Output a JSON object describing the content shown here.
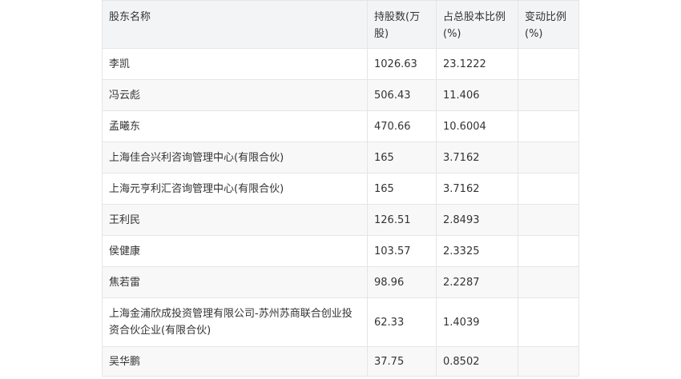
{
  "headers": [
    "股东名称",
    "持股数(万股)",
    "占总股本比例(%)",
    "变动比例(%)"
  ],
  "rows": [
    [
      "李凯",
      "1026.63",
      "23.1222",
      ""
    ],
    [
      "冯云彪",
      "506.43",
      "11.406",
      ""
    ],
    [
      "孟曦东",
      "470.66",
      "10.6004",
      ""
    ],
    [
      "上海佳合兴利咨询管理中心(有限合伙)",
      "165",
      "3.7162",
      ""
    ],
    [
      "上海元亨利汇咨询管理中心(有限合伙)",
      "165",
      "3.7162",
      ""
    ],
    [
      "王利民",
      "126.51",
      "2.8493",
      ""
    ],
    [
      "侯健康",
      "103.57",
      "2.3325",
      ""
    ],
    [
      "焦若雷",
      "98.96",
      "2.2287",
      ""
    ],
    [
      "上海金浦欣成投资管理有限公司-苏州苏商联合创业投资合伙企业(有限合伙)",
      "62.33",
      "1.4039",
      ""
    ],
    [
      "吴华鹏",
      "37.75",
      "0.8502",
      ""
    ]
  ]
}
